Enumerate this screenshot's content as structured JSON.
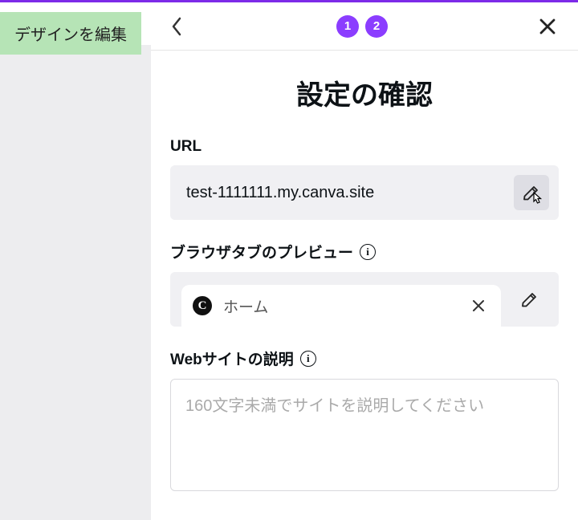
{
  "sidebar": {
    "edit_design_label": "デザインを編集"
  },
  "header": {
    "step1": "1",
    "step2": "2"
  },
  "title": "設定の確認",
  "url_section": {
    "label": "URL",
    "value": "test-1111111.my.canva.site"
  },
  "tab_preview_section": {
    "label": "ブラウザタブのプレビュー",
    "tab_title": "ホーム"
  },
  "description_section": {
    "label": "Webサイトの説明",
    "placeholder": "160文字未満でサイトを説明してください"
  },
  "info_glyph": "i",
  "favicon_glyph": "C"
}
